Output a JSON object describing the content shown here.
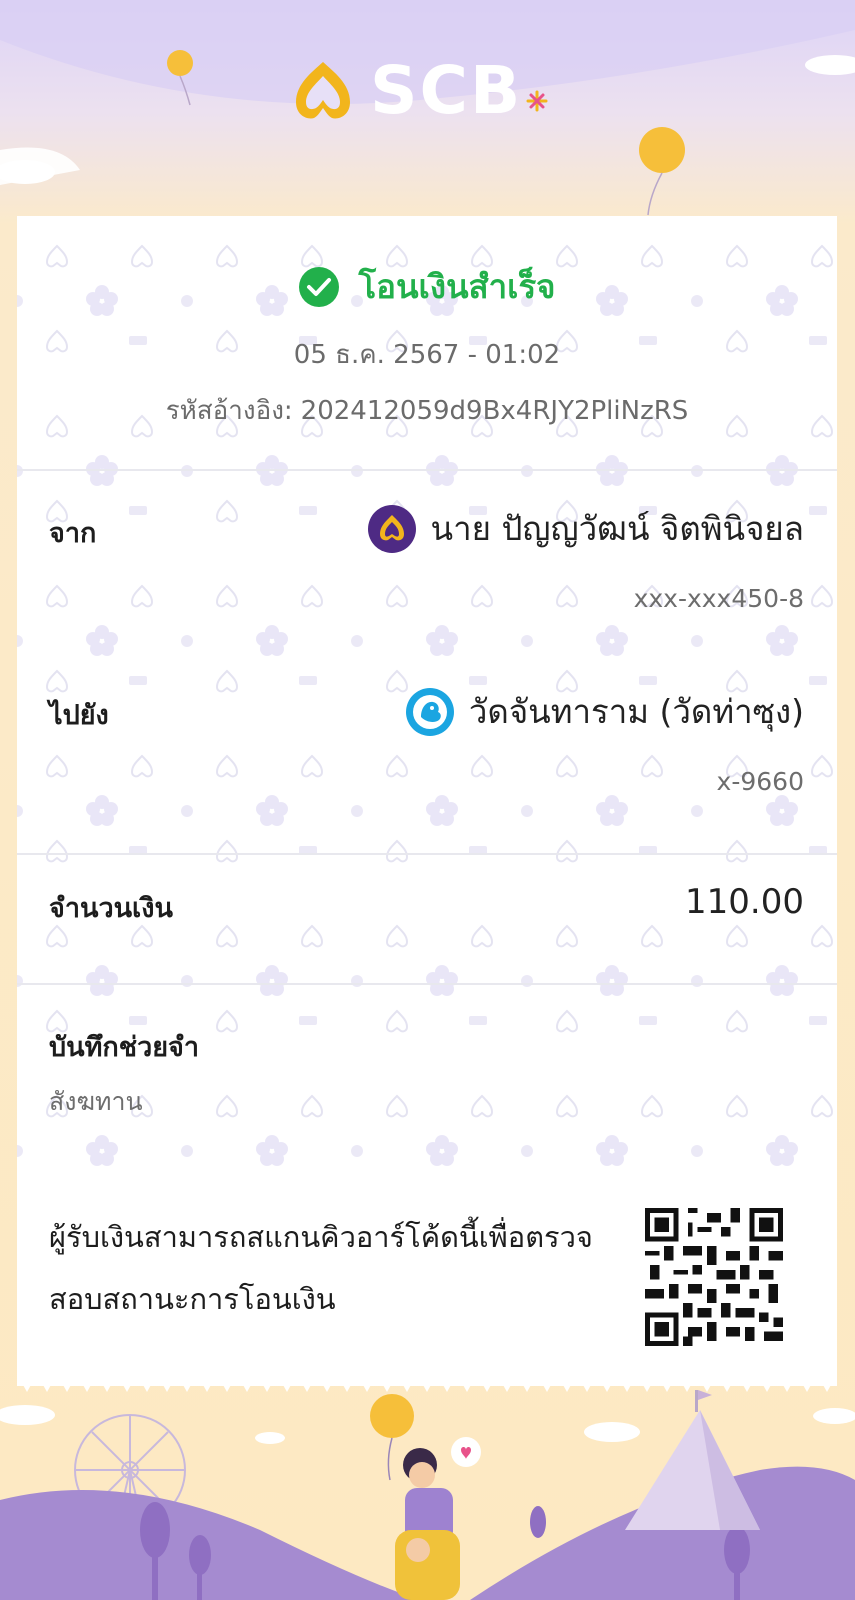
{
  "brand": {
    "name": "SCB"
  },
  "status": {
    "title": "โอนเงินสำเร็จ",
    "icon": "check-circle-icon",
    "color": "#22b04b"
  },
  "datetime": "05 ธ.ค. 2567 - 01:02",
  "reference": {
    "label": "รหัสอ้างอิง:",
    "value": "202412059d9Bx4RJY2PliNzRS"
  },
  "from": {
    "label": "จาก",
    "name": "นาย ปัญญวัฒน์ จิตพินิจยล",
    "account": "xxx-xxx450-8",
    "bank_icon": "scb-bank-icon"
  },
  "to": {
    "label": "ไปยัง",
    "name": "วัดจันทาราม (วัดท่าซุง)",
    "account": "x-9660",
    "bank_icon": "ktb-bank-icon"
  },
  "amount": {
    "label": "จำนวนเงิน",
    "value": "110.00"
  },
  "memo": {
    "label": "บันทึกช่วยจำ",
    "value": "สังฆทาน"
  },
  "qr": {
    "text": "ผู้รับเงินสามารถสแกนคิวอาร์โค้ดนี้เพื่อตรวจสอบสถานะการโอนเงิน",
    "icon": "qr-code-icon"
  },
  "colors": {
    "brand_purple": "#4e2a84",
    "brand_gold": "#f2b51c",
    "success": "#22b04b"
  }
}
